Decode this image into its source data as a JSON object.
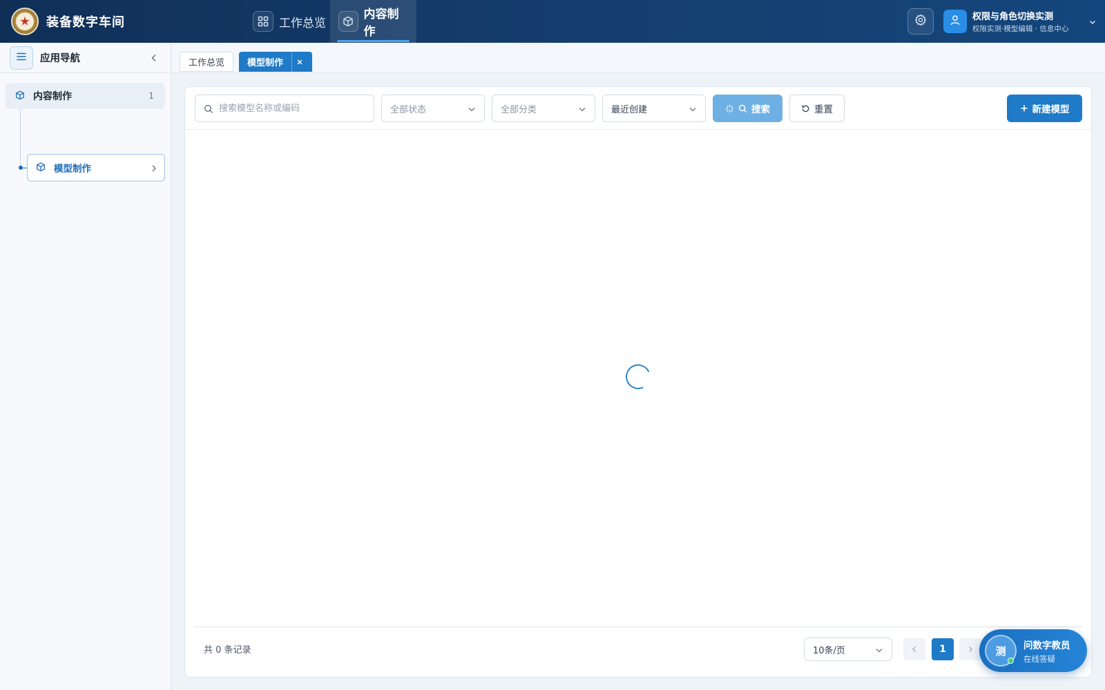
{
  "header": {
    "app_title": "装备数字车间",
    "nav": [
      {
        "label": "工作总览",
        "icon": "grid-icon"
      },
      {
        "label": "内容制作",
        "icon": "cube-icon",
        "active": true
      }
    ],
    "user": {
      "name": "权限与角色切换实测",
      "subtitle": "权限实测·模型编辑 · 信息中心"
    }
  },
  "sidebar": {
    "title": "应用导航",
    "group": {
      "label": "内容制作",
      "count": "1"
    },
    "items": [
      {
        "label": "模型制作",
        "active": true
      }
    ]
  },
  "tabs": [
    {
      "label": "工作总览",
      "active": false
    },
    {
      "label": "模型制作",
      "active": true,
      "closable": true
    }
  ],
  "toolbar": {
    "search_placeholder": "搜索模型名称或编码",
    "status_select": "全部状态",
    "category_select": "全部分类",
    "sort_select": "最近创建",
    "search_label": "搜索",
    "reset_label": "重置",
    "new_label": "新建模型"
  },
  "footer": {
    "record_count": "共 0 条记录",
    "page_size": "10条/页",
    "current_page": "1"
  },
  "assistant": {
    "avatar_text": "测",
    "title": "问数字教员",
    "subtitle": "在线答疑"
  },
  "colors": {
    "header_bg": "#13467c",
    "accent": "#1f7ac7",
    "search_button_loading": "#6fb0e4",
    "online": "#3ed07a"
  }
}
